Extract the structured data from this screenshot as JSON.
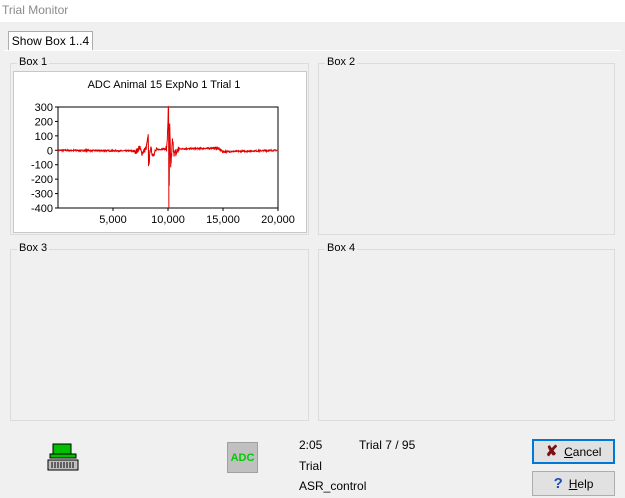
{
  "window": {
    "title": "Trial Monitor"
  },
  "tabs": [
    {
      "label": "Show Box 1..4"
    }
  ],
  "boxes": [
    {
      "label": "Box 1"
    },
    {
      "label": "Box 2"
    },
    {
      "label": "Box 3"
    },
    {
      "label": "Box 4"
    }
  ],
  "chart_data": {
    "type": "line",
    "title": "ADC  Animal 15  ExpNo 1  Trial 1",
    "xlabel": "",
    "ylabel": "",
    "xlim": [
      0,
      20000
    ],
    "ylim": [
      -400,
      300
    ],
    "x_ticks": [
      5000,
      10000,
      15000,
      20000
    ],
    "x_tick_labels": [
      "5,000",
      "10,000",
      "15,000",
      "20,000"
    ],
    "y_ticks": [
      300,
      200,
      100,
      0,
      -100,
      -200,
      -300,
      -400
    ],
    "y_tick_labels": [
      "300",
      "200",
      "100",
      "0",
      "-100",
      "-200",
      "-300",
      "-400"
    ],
    "vertical_gridlines_at": [
      5000,
      10000,
      15000
    ],
    "series": [
      {
        "color": "#e00000",
        "description_points": [
          {
            "x": 0,
            "y": 0
          },
          {
            "x": 7200,
            "y": -5
          },
          {
            "x": 7400,
            "y": 25
          },
          {
            "x": 7600,
            "y": -20
          },
          {
            "x": 8000,
            "y": 10
          },
          {
            "x": 8200,
            "y": 95
          },
          {
            "x": 8250,
            "y": -110
          },
          {
            "x": 8400,
            "y": 20
          },
          {
            "x": 8600,
            "y": -30
          },
          {
            "x": 9000,
            "y": 5
          },
          {
            "x": 9900,
            "y": 10
          },
          {
            "x": 10050,
            "y": 330
          },
          {
            "x": 10100,
            "y": -400
          },
          {
            "x": 10150,
            "y": 180
          },
          {
            "x": 10250,
            "y": -120
          },
          {
            "x": 10400,
            "y": 60
          },
          {
            "x": 10600,
            "y": -30
          },
          {
            "x": 11000,
            "y": 10
          },
          {
            "x": 14500,
            "y": 15
          },
          {
            "x": 15000,
            "y": -10
          },
          {
            "x": 20000,
            "y": 0
          }
        ]
      }
    ],
    "grid": "vertical dashed"
  },
  "status": {
    "time": "2:05",
    "trial": "Trial 7 / 95",
    "mode": "Trial",
    "protocol": "ASR_control"
  },
  "icons": {
    "device": "keyboard-device-icon",
    "adc": "adc-icon",
    "adc_label": "ADC",
    "adc_color": "#00cc00"
  },
  "buttons": {
    "cancel": {
      "prefix": "",
      "underline": "C",
      "rest": "ancel"
    },
    "help": {
      "underline": "H",
      "rest": "elp"
    }
  }
}
